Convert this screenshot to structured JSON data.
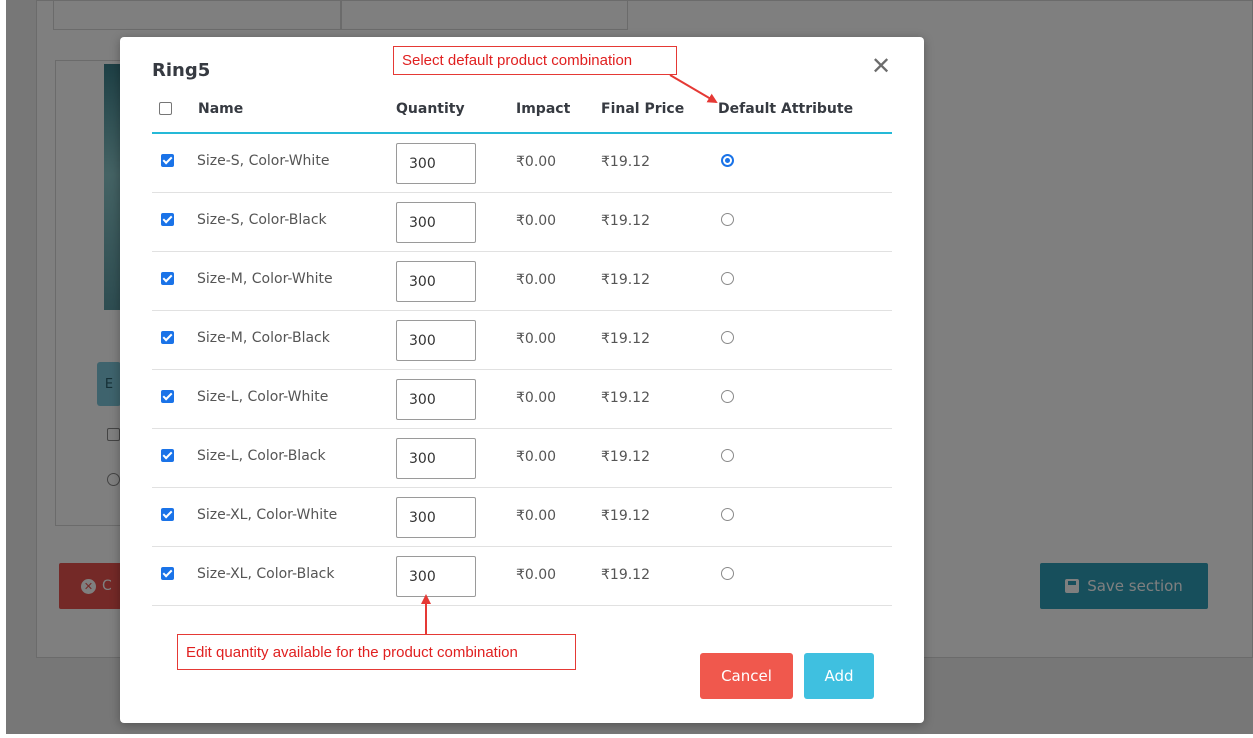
{
  "background": {
    "edit_button_label": "E",
    "cancel_button_label": "C",
    "save_button_label": "Save section"
  },
  "modal": {
    "title": "Ring5",
    "headers": {
      "name": "Name",
      "quantity": "Quantity",
      "impact": "Impact",
      "final_price": "Final Price",
      "default_attribute": "Default Attribute"
    },
    "rows": [
      {
        "name": "Size-S, Color-White",
        "quantity": "300",
        "impact": "₹0.00",
        "final_price": "₹19.12",
        "checked": true,
        "default": true
      },
      {
        "name": "Size-S, Color-Black",
        "quantity": "300",
        "impact": "₹0.00",
        "final_price": "₹19.12",
        "checked": true,
        "default": false
      },
      {
        "name": "Size-M, Color-White",
        "quantity": "300",
        "impact": "₹0.00",
        "final_price": "₹19.12",
        "checked": true,
        "default": false
      },
      {
        "name": "Size-M, Color-Black",
        "quantity": "300",
        "impact": "₹0.00",
        "final_price": "₹19.12",
        "checked": true,
        "default": false
      },
      {
        "name": "Size-L, Color-White",
        "quantity": "300",
        "impact": "₹0.00",
        "final_price": "₹19.12",
        "checked": true,
        "default": false
      },
      {
        "name": "Size-L, Color-Black",
        "quantity": "300",
        "impact": "₹0.00",
        "final_price": "₹19.12",
        "checked": true,
        "default": false
      },
      {
        "name": "Size-XL, Color-White",
        "quantity": "300",
        "impact": "₹0.00",
        "final_price": "₹19.12",
        "checked": true,
        "default": false
      },
      {
        "name": "Size-XL, Color-Black",
        "quantity": "300",
        "impact": "₹0.00",
        "final_price": "₹19.12",
        "checked": true,
        "default": false
      }
    ],
    "cancel_label": "Cancel",
    "add_label": "Add",
    "close_icon": "close-icon"
  },
  "annotations": {
    "top_callout": "Select default product combination",
    "bottom_callout": "Edit quantity available for the product combination"
  },
  "colors": {
    "accent": "#25b9d7",
    "cancel": "#f0584d",
    "add": "#3fc0e0",
    "annotation": "#e53935"
  }
}
